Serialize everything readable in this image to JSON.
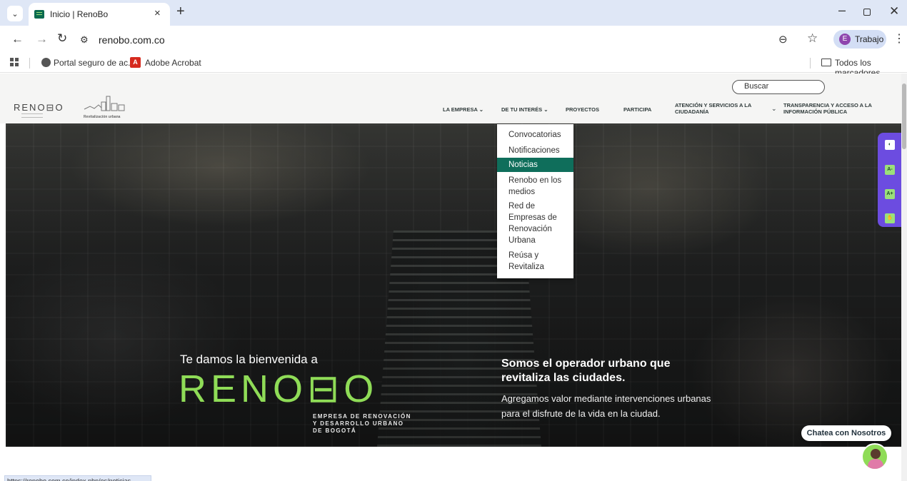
{
  "browser": {
    "tab_title": "Inicio | RenoBo",
    "url": "renobo.com.co",
    "profile_initial": "E",
    "profile_label": "Trabajo",
    "bookmarks": [
      {
        "label": "Portal seguro de ac...",
        "icon": "globe-icon"
      },
      {
        "label": "Adobe Acrobat",
        "icon": "acrobat-icon"
      }
    ],
    "all_bookmarks_label": "Todos los marcadores",
    "status_url": "https://renobo.com.co/index.php/es/noticias"
  },
  "site": {
    "search_placeholder": "Buscar",
    "logo_text": "RENO⊟O",
    "logo2_text": "Revitalización urbana",
    "nav": {
      "empresa": "LA EMPRESA",
      "interes": "DE TU INTERÉS",
      "proyectos": "PROYECTOS",
      "participa": "PARTICIPA",
      "atencion_1": "ATENCIÓN Y SERVICIOS A LA",
      "atencion_2": "CIUDADANÍA",
      "transparencia_1": "TRANSPARENCIA Y ACCESO A LA",
      "transparencia_2": "INFORMACIÓN PÚBLICA"
    },
    "dropdown": [
      {
        "label": "Convocatorias",
        "active": false
      },
      {
        "label": "Notificaciones",
        "active": false
      },
      {
        "label": "Noticias",
        "active": true
      },
      {
        "label": "Renobo en los medios",
        "active": false
      },
      {
        "label": "Red de Empresas de Renovación Urbana",
        "active": false
      },
      {
        "label": "Reúsa y Revitaliza",
        "active": false
      }
    ],
    "hero": {
      "welcome": "Te damos la bienvenida a",
      "big_logo": "RENO⊟O",
      "sub_1": "EMPRESA DE RENOVACIÓN",
      "sub_2": "Y DESARROLLO URBANO",
      "sub_3": "DE BOGOTÁ",
      "headline": "Somos el operador urbano que revitaliza las ciudades.",
      "paragraph": "Agregamos valor mediante intervenciones urbanas para el disfrute de la vida en la ciudad."
    },
    "accessibility": [
      "contrast-icon",
      "text-smaller-icon",
      "text-larger-icon",
      "sign-language-icon"
    ],
    "a11y_labels": {
      "smaller": "A-",
      "larger": "A+"
    },
    "chat_label": "Chatea con Nosotros",
    "colors": {
      "brand_green": "#8fdc57",
      "menu_active": "#0f6e5b",
      "a11y_purple": "#6c4ce0"
    }
  }
}
